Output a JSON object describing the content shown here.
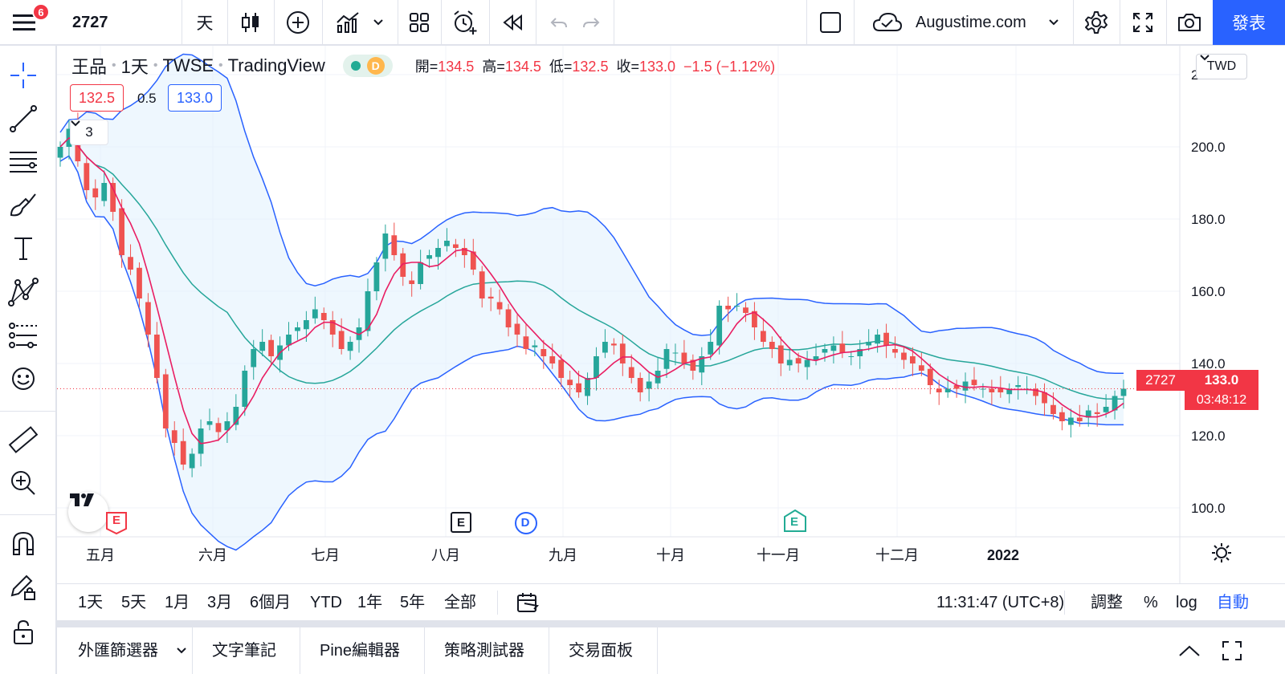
{
  "topbar": {
    "menu_badge": "6",
    "symbol": "2727",
    "interval": "天",
    "domain": "Augustime.com",
    "publish": "發表"
  },
  "legend": {
    "name": "王品",
    "interval": "1天",
    "exchange": "TWSE",
    "source": "TradingView",
    "status_letter": "D",
    "open_label": "開=",
    "open": "134.5",
    "high_label": "高=",
    "high": "134.5",
    "low_label": "低=",
    "low": "132.5",
    "close_label": "收=",
    "close": "133.0",
    "change": "−1.5 (−1.12%)"
  },
  "quote": {
    "bid": "132.5",
    "spread": "0.5",
    "ask": "133.0"
  },
  "indicators_count": "3",
  "currency": "TWD",
  "price_tag": {
    "symbol": "2727",
    "price": "133.0",
    "countdown": "03:48:12"
  },
  "price_axis_labels": [
    "220.0",
    "200.0",
    "180.0",
    "160.0",
    "140.0",
    "120.0",
    "100.0"
  ],
  "time_axis_labels": [
    "五月",
    "六月",
    "七月",
    "八月",
    "九月",
    "十月",
    "十一月",
    "十二月",
    "2022"
  ],
  "events": [
    {
      "label": "E",
      "kind": "earnings-red"
    },
    {
      "label": "E",
      "kind": "earnings-dark"
    },
    {
      "label": "D",
      "kind": "dividend"
    },
    {
      "label": "E",
      "kind": "earnings-green"
    }
  ],
  "ranges": [
    "1天",
    "5天",
    "1月",
    "3月",
    "6個月",
    "YTD",
    "1年",
    "5年",
    "全部"
  ],
  "clock": "11:31:47 (UTC+8)",
  "scale_options": {
    "adjust": "調整",
    "percent": "%",
    "log": "log",
    "auto": "自動"
  },
  "panels": [
    "外匯篩選器",
    "文字筆記",
    "Pine編輯器",
    "策略測試器",
    "交易面板"
  ],
  "chart_data": {
    "type": "candlestick",
    "title": "王品 · 1天 · TWSE",
    "ylim": [
      92,
      228
    ],
    "grid": true,
    "overlays": [
      "bollinger-upper",
      "bollinger-basis",
      "bollinger-lower",
      "moving-average"
    ],
    "colors": {
      "up": "#26a69a",
      "down": "#ef5350",
      "band_line": "#2962ff",
      "basis": "#26a69a",
      "ma": "#e91e63",
      "band_fill": "#e3f2fd"
    },
    "close_series": [
      200,
      205,
      196,
      188,
      186,
      190,
      182,
      170,
      166,
      158,
      148,
      136,
      122,
      118,
      112,
      115,
      122,
      124,
      121,
      124,
      128,
      138,
      144,
      146,
      142,
      145,
      148,
      150,
      152,
      155,
      152,
      148,
      144,
      146,
      150,
      160,
      168,
      176,
      170,
      164,
      162,
      168,
      170,
      172,
      174,
      172,
      170,
      166,
      158,
      158,
      155,
      150,
      148,
      144,
      145,
      142,
      140,
      136,
      134,
      132,
      136,
      142,
      146,
      145,
      140,
      136,
      132,
      135,
      138,
      144,
      143,
      140,
      138,
      142,
      146,
      156,
      155,
      156,
      154,
      150,
      146,
      144,
      140,
      141,
      140,
      141,
      142,
      144,
      145,
      143,
      142,
      144,
      146,
      148,
      145,
      143,
      141,
      140,
      138,
      134,
      132,
      133,
      133,
      135,
      134,
      133,
      132,
      132,
      133,
      134,
      133,
      131,
      129,
      126,
      124,
      125,
      124,
      127,
      126,
      128,
      131,
      133
    ]
  }
}
